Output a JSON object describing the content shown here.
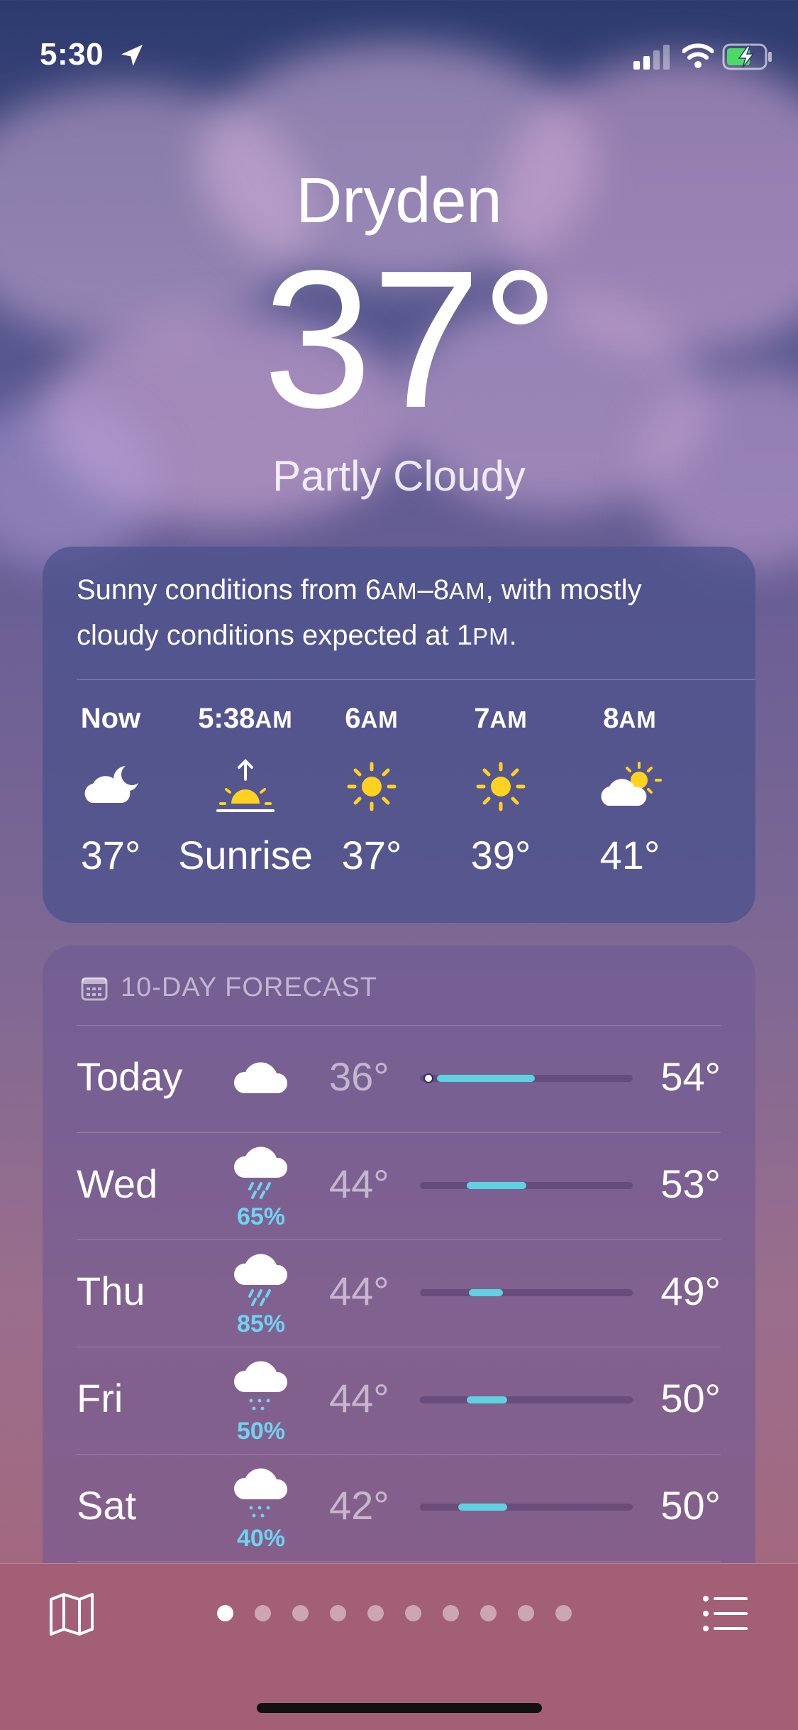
{
  "status_bar": {
    "time": "5:30"
  },
  "location": {
    "city": "Dryden",
    "temperature": "37°",
    "condition": "Partly Cloudy"
  },
  "hourly": {
    "summary_part1": "Sunny conditions from 6",
    "summary_am1": "AM",
    "summary_part2": "–8",
    "summary_am2": "AM",
    "summary_part3": ", with mostly cloudy conditions expected at 1",
    "summary_pm": "PM",
    "summary_end": ".",
    "hours": [
      {
        "num": "Now",
        "suffix": "",
        "icon": "partly-cloudy-night-icon",
        "value": "37°"
      },
      {
        "num": "5:38",
        "suffix": "AM",
        "icon": "sunrise-icon",
        "value": "Sunrise"
      },
      {
        "num": "6",
        "suffix": "AM",
        "icon": "sun-icon",
        "value": "37°"
      },
      {
        "num": "7",
        "suffix": "AM",
        "icon": "sun-icon",
        "value": "39°"
      },
      {
        "num": "8",
        "suffix": "AM",
        "icon": "partly-cloudy-day-icon",
        "value": "41°"
      }
    ]
  },
  "forecast": {
    "header": "10-DAY FORECAST",
    "days": [
      {
        "day": "Today",
        "icon": "cloud-icon",
        "precip": "",
        "low": "36°",
        "high": "54°",
        "bar_start": 0.08,
        "bar_end": 0.54,
        "current": 0.04
      },
      {
        "day": "Wed",
        "icon": "rain-cloud-icon",
        "precip": "65%",
        "low": "44°",
        "high": "53°",
        "bar_start": 0.22,
        "bar_end": 0.5
      },
      {
        "day": "Thu",
        "icon": "rain-cloud-icon",
        "precip": "85%",
        "low": "44°",
        "high": "49°",
        "bar_start": 0.23,
        "bar_end": 0.39
      },
      {
        "day": "Fri",
        "icon": "drizzle-cloud-icon",
        "precip": "50%",
        "low": "44°",
        "high": "50°",
        "bar_start": 0.22,
        "bar_end": 0.41
      },
      {
        "day": "Sat",
        "icon": "drizzle-cloud-icon",
        "precip": "40%",
        "low": "42°",
        "high": "50°",
        "bar_start": 0.18,
        "bar_end": 0.41
      }
    ]
  },
  "toolbar": {
    "pages": 10,
    "active_page": 1
  }
}
